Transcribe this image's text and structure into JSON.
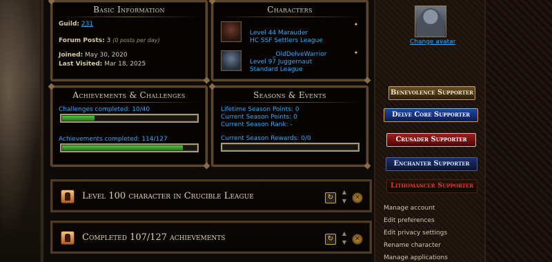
{
  "basic_info": {
    "title": "Basic Information",
    "guild_label": "Guild:",
    "guild_value": "231",
    "forum_posts_label": "Forum Posts:",
    "forum_posts_value": "3",
    "forum_posts_note": "(0 posts per day)",
    "joined_label": "Joined:",
    "joined_value": "May 30, 2020",
    "last_visited_label": "Last Visited:",
    "last_visited_value": "Mar 18, 2025"
  },
  "characters": {
    "title": "Characters",
    "items": [
      {
        "name": "",
        "level": "Level 44 Marauder",
        "league": "HC SSF Settlers League",
        "portrait": "marauder-portrait-icon"
      },
      {
        "name": "_OldDelveWarrior",
        "level": "Level 97 Juggernaut",
        "league": "Standard League",
        "portrait": "juggernaut-portrait-icon"
      }
    ]
  },
  "achievements": {
    "title": "Achievements & Challenges",
    "challenges_label": "Challenges completed: 10/40",
    "challenges_progress": 0.25,
    "achievements_label": "Achievements completed: 114/127",
    "achievements_progress": 0.898
  },
  "seasons": {
    "title": "Seasons & Events",
    "lifetime_points": "Lifetime Season Points: 0",
    "current_points": "Current Season Points: 0",
    "current_rank": "Current Season Rank: -",
    "current_rewards": "Current Season Rewards: 0/0",
    "rewards_progress": 0
  },
  "achievement_rows": [
    {
      "title": "Level 100 character in Crucible League",
      "icon": "achievement-icon"
    },
    {
      "title": "Completed 107/127 achievements",
      "icon": "achievement-icon"
    }
  ],
  "sidebar": {
    "change_avatar": "Change avatar",
    "supporter_badges": [
      "Benevolence Supporter",
      "Delve Core Supporter",
      "Crusader Supporter",
      "Enchanter Supporter",
      "Lithomancer Supporter"
    ],
    "links": [
      "Manage account",
      "Edit preferences",
      "Edit privacy settings",
      "Rename character",
      "Manage applications"
    ]
  },
  "icons": {
    "refresh": "↻",
    "arrows_up": "▲",
    "arrows_down": "▼",
    "remove": "✕",
    "badge": "✦"
  }
}
